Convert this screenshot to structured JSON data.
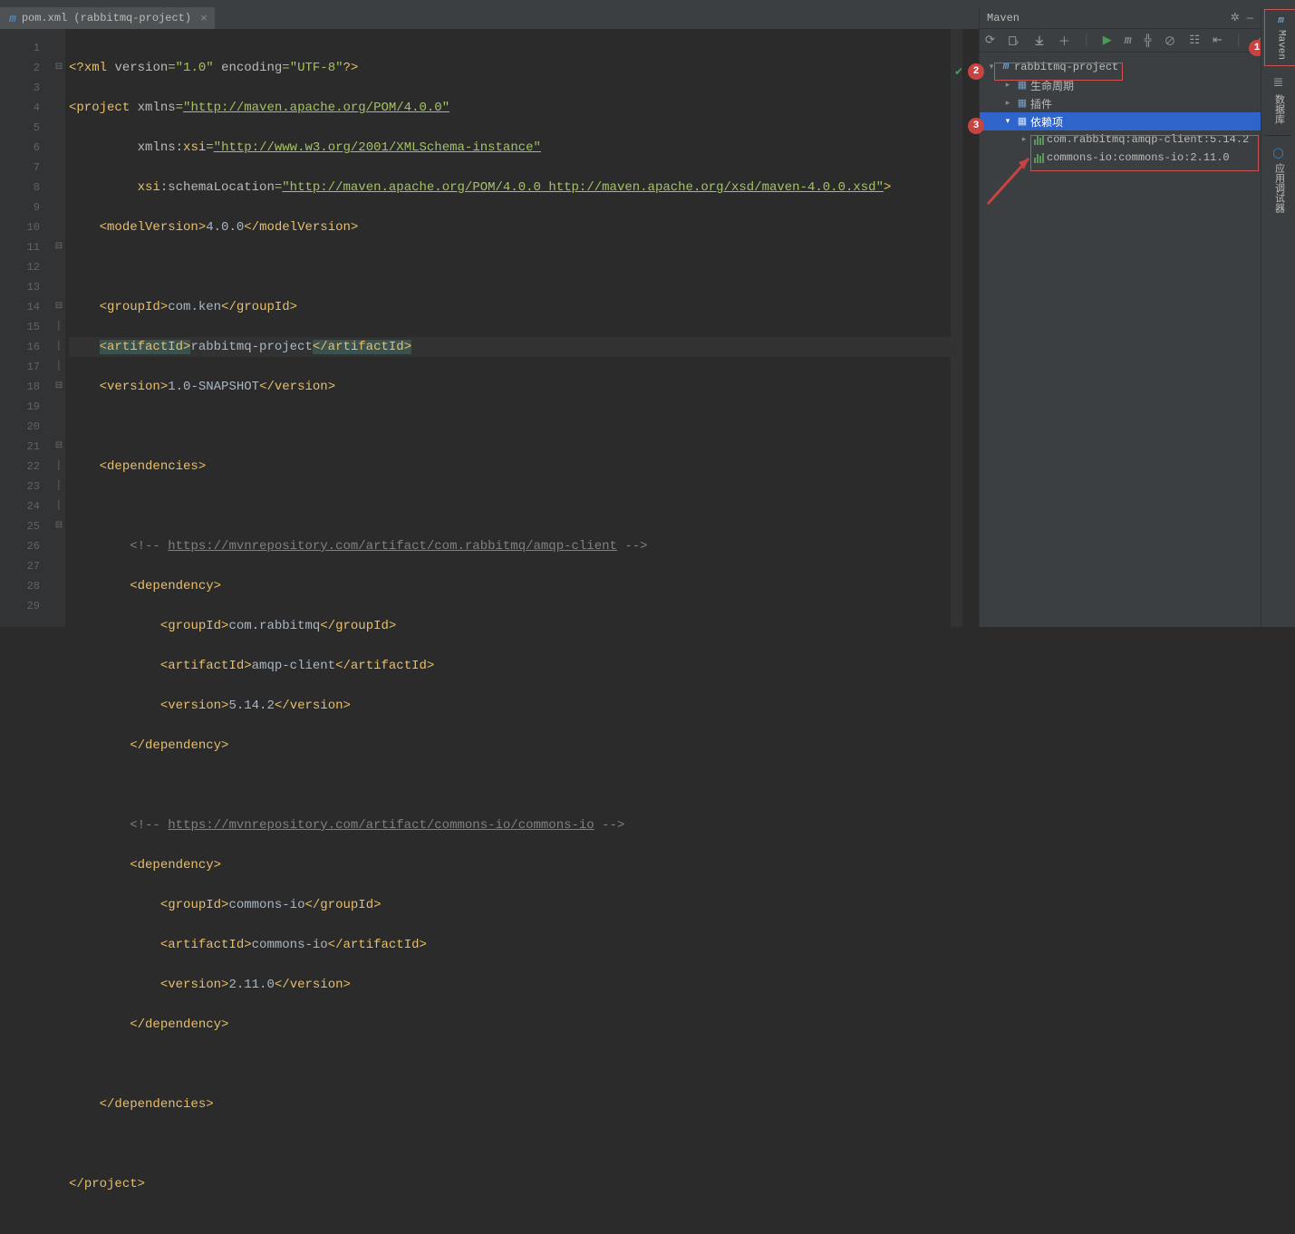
{
  "tab": {
    "label": "pom.xml (rabbitmq-project)"
  },
  "editor": {
    "lines": 29,
    "highlight_line": 8
  },
  "code": {
    "xml_decl_pre": "<?",
    "xml_decl_name": "xml",
    "xml_decl_ver_attr": "version",
    "xml_decl_ver_val": "\"1.0\"",
    "xml_decl_enc_attr": "encoding",
    "xml_decl_enc_val": "\"UTF-8\"",
    "xml_decl_post": "?>",
    "project": "project",
    "xmlns_attr": "xmlns",
    "xmlns_val": "\"http://maven.apache.org/POM/4.0.0\"",
    "xmlnsxsi_attr": "xmlns:",
    "xmlnsxsi_attr2": "xsi",
    "xmlnsxsi_val": "\"http://www.w3.org/2001/XMLSchema-instance\"",
    "xsisl_attr1": "xsi",
    "xsisl_attr2": ":schemaLocation",
    "xsisl_val": "\"http://maven.apache.org/POM/4.0.0 http://maven.apache.org/xsd/maven-4.0.0.xsd\"",
    "modelVersion_tag": "modelVersion",
    "modelVersion_txt": "4.0.0",
    "groupId_tag": "groupId",
    "groupId_txt": "com.ken",
    "artifactId_tag": "artifactId",
    "artifactId_txt": "rabbitmq-project",
    "version_tag": "version",
    "version_txt": "1.0-SNAPSHOT",
    "dependencies_tag": "dependencies",
    "cmt1_pre": "<!-- ",
    "cmt1_url": "https://mvnrepository.com/artifact/com.rabbitmq/amqp-client",
    "cmt1_post": " -->",
    "dependency_tag": "dependency",
    "dep1_group": "com.rabbitmq",
    "dep1_art": "amqp-client",
    "dep1_ver": "5.14.2",
    "cmt2_pre": "<!-- ",
    "cmt2_url": "https://mvnrepository.com/artifact/commons-io/commons-io",
    "cmt2_post": " -->",
    "dep2_group": "commons-io",
    "dep2_art": "commons-io",
    "dep2_ver": "2.11.0"
  },
  "maven": {
    "title": "Maven",
    "project_name": "rabbitmq-project",
    "lifecycle": "生命周期",
    "plugins": "插件",
    "deps": "依赖项",
    "dep_items": [
      "com.rabbitmq:amqp-client:5.14.2",
      "commons-io:commons-io:2.11.0"
    ]
  },
  "rsb": {
    "maven": "Maven",
    "db": "数据库",
    "app": "应用调试器"
  },
  "annot": {
    "n1": "1",
    "n2": "2",
    "n3": "3"
  }
}
